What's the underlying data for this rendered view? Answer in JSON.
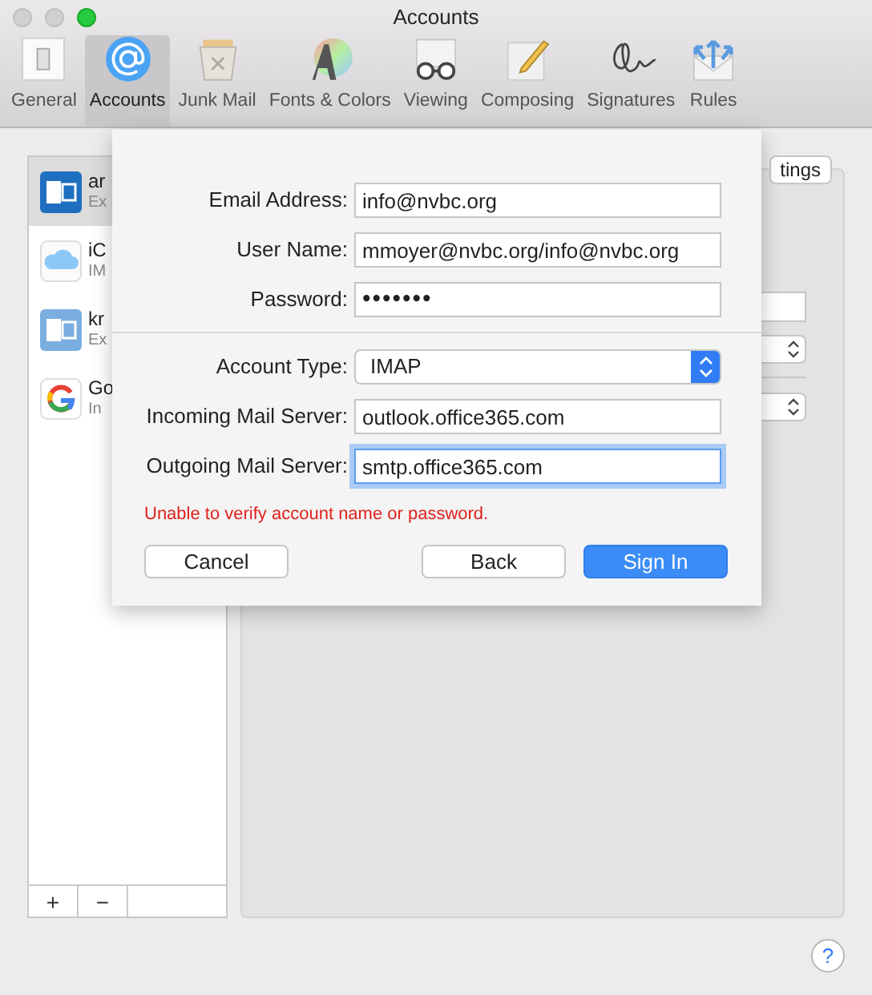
{
  "window": {
    "title": "Accounts"
  },
  "toolbar": [
    {
      "label": "General",
      "kind": "general",
      "selected": false
    },
    {
      "label": "Accounts",
      "kind": "accounts",
      "selected": true
    },
    {
      "label": "Junk Mail",
      "kind": "junk",
      "selected": false
    },
    {
      "label": "Fonts & Colors",
      "kind": "fonts",
      "selected": false
    },
    {
      "label": "Viewing",
      "kind": "viewing",
      "selected": false
    },
    {
      "label": "Composing",
      "kind": "composing",
      "selected": false
    },
    {
      "label": "Signatures",
      "kind": "signatures",
      "selected": false
    },
    {
      "label": "Rules",
      "kind": "rules",
      "selected": false
    }
  ],
  "accounts": [
    {
      "name": "ar",
      "subtitle": "Ex",
      "kind": "exchange",
      "selected": true
    },
    {
      "name": "iC",
      "subtitle": "IM",
      "kind": "icloud",
      "selected": false
    },
    {
      "name": "kr",
      "subtitle": "Ex",
      "kind": "exchange",
      "selected": false
    },
    {
      "name": "Go",
      "subtitle": "In",
      "kind": "google",
      "selected": false
    }
  ],
  "list_buttons": [
    "+",
    "−"
  ],
  "details": {
    "button": "tings"
  },
  "sheet": {
    "fields": [
      {
        "label": "Email Address:",
        "value": "info@nvbc.org",
        "kind": "text",
        "focused": false
      },
      {
        "label": "User Name:",
        "value": "mmoyer@nvbc.org/info@nvbc.org",
        "kind": "text",
        "focused": false
      },
      {
        "label": "Password:",
        "value": "•••••••",
        "kind": "password",
        "focused": false
      },
      {
        "label": "Account Type:",
        "value": "IMAP",
        "kind": "select"
      },
      {
        "label": "Incoming Mail Server:",
        "value": "outlook.office365.com",
        "kind": "text",
        "focused": false
      },
      {
        "label": "Outgoing Mail Server:",
        "value": "smtp.office365.com",
        "kind": "text",
        "focused": true
      }
    ],
    "error": "Unable to verify account name or password.",
    "buttons": [
      {
        "label": "Cancel",
        "kind": "cancel"
      },
      {
        "label": "Back",
        "kind": "back"
      },
      {
        "label": "Sign In",
        "kind": "primary"
      }
    ]
  },
  "help": "?"
}
